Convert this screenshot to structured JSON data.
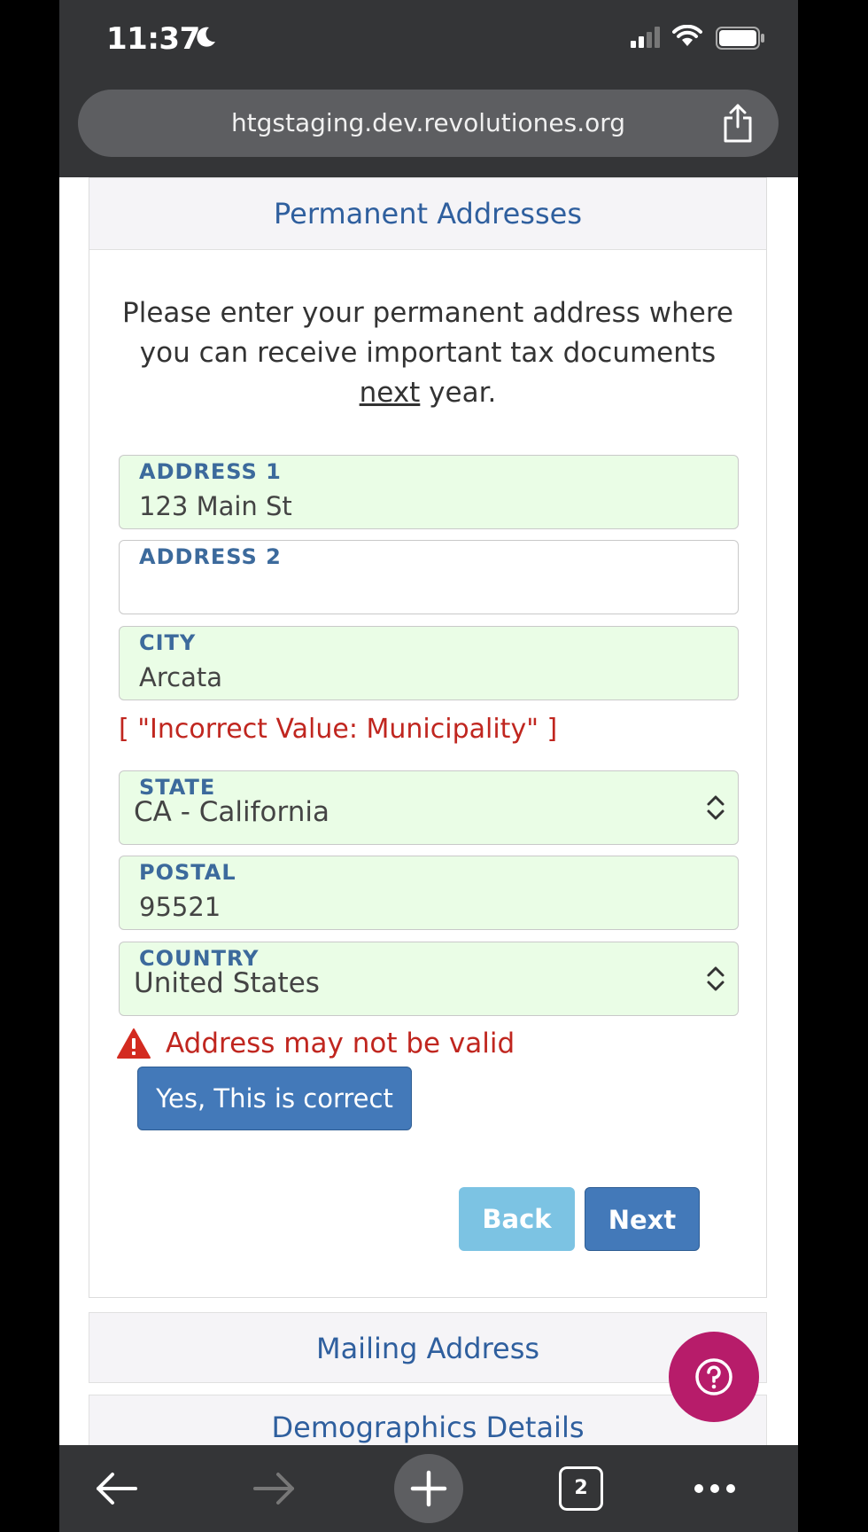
{
  "status_bar": {
    "time": "11:37"
  },
  "browser": {
    "url": "htgstaging.dev.revolutiones.org",
    "open_tabs": "2"
  },
  "form": {
    "header": "Permanent Addresses",
    "instructions_before": "Please enter your permanent address where you can receive important tax documents ",
    "instructions_emphasis": "next",
    "instructions_after": " year.",
    "fields": {
      "address1": {
        "label": "ADDRESS 1",
        "value": "123 Main St"
      },
      "address2": {
        "label": "ADDRESS 2",
        "value": ""
      },
      "city": {
        "label": "CITY",
        "value": "Arcata"
      },
      "state": {
        "label": "STATE",
        "value": "CA - California"
      },
      "postal": {
        "label": "POSTAL",
        "value": "95521"
      },
      "country": {
        "label": "COUNTRY",
        "value": "United States"
      }
    },
    "city_error": "[ \"Incorrect Value: Municipality\" ]",
    "address_warning": "Address may not be valid",
    "confirm_label": "Yes, This is correct",
    "back_label": "Back",
    "next_label": "Next"
  },
  "sections": {
    "mailing": "Mailing Address",
    "demographics": "Demographics Details"
  },
  "colors": {
    "valid_field_bg": "#eafde6",
    "error_red": "#c0261f",
    "primary_blue": "#4379b9",
    "help_magenta": "#b71c6a"
  }
}
